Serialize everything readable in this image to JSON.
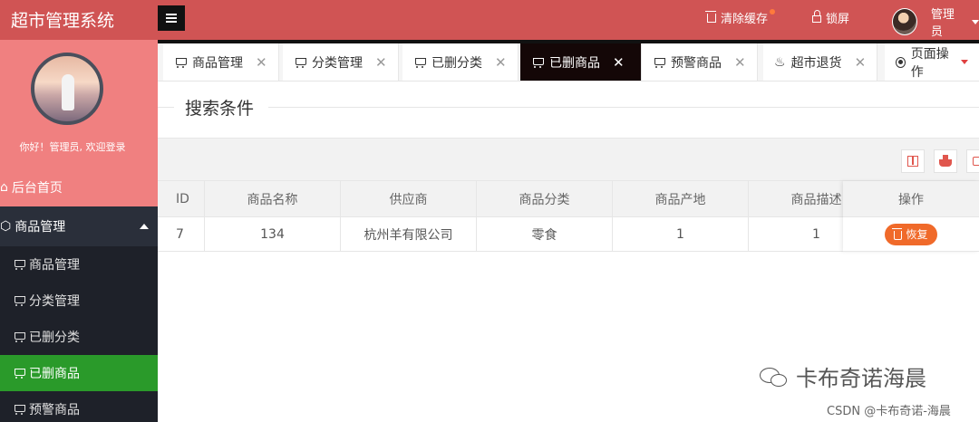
{
  "header": {
    "logo": "超市管理系统",
    "clear_cache": "清除缓存",
    "lock_screen": "锁屏",
    "user_name": "管理员"
  },
  "sidebar": {
    "greeting": "你好！管理员, 欢迎登录",
    "home": "后台首页",
    "group": "商品管理",
    "items": [
      {
        "label": "商品管理"
      },
      {
        "label": "分类管理"
      },
      {
        "label": "已删分类"
      },
      {
        "label": "已删商品"
      },
      {
        "label": "预警商品"
      }
    ],
    "active_item": "已删商品"
  },
  "tabs": [
    {
      "label": "商品管理"
    },
    {
      "label": "分类管理"
    },
    {
      "label": "已删分类"
    },
    {
      "label": "已删商品"
    },
    {
      "label": "预警商品"
    },
    {
      "label": "超市退货"
    }
  ],
  "page_ops": "页面操作",
  "search": {
    "legend": "搜索条件"
  },
  "table": {
    "columns": [
      "ID",
      "商品名称",
      "供应商",
      "商品分类",
      "商品产地",
      "商品描述",
      "操作"
    ],
    "rows": [
      {
        "id": "7",
        "name": "134",
        "supplier": "杭州羊有限公司",
        "category": "零食",
        "origin": "1",
        "desc": "1"
      }
    ],
    "restore_label": "恢复"
  },
  "watermark": {
    "line1": "卡布奇诺海晨",
    "line2": "CSDN @卡布奇诺-海晨"
  },
  "colors": {
    "header_bg": "#d05454",
    "profile_bg": "#f08080",
    "active_nav": "#2a9a2a",
    "restore_btn": "#f06a2a"
  }
}
